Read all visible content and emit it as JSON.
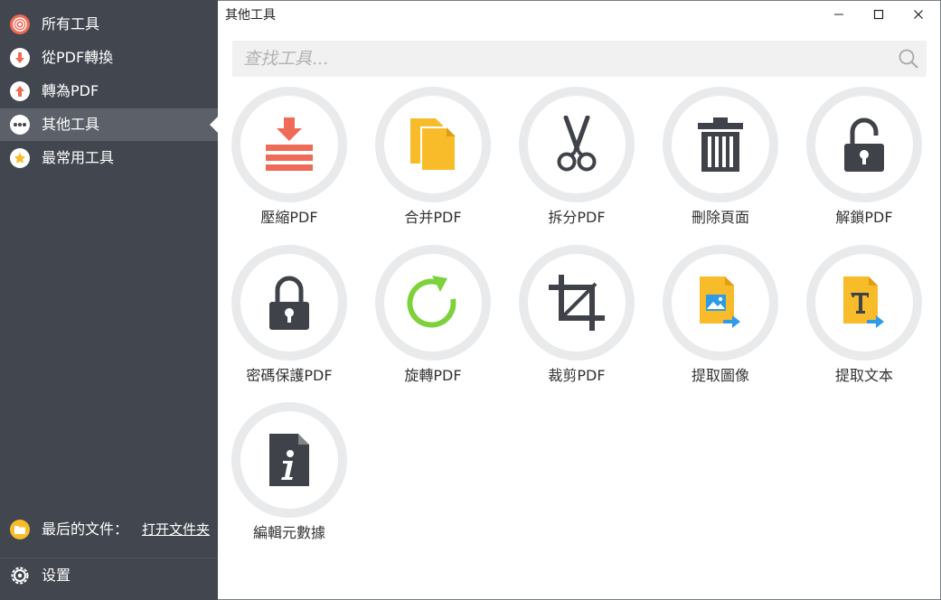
{
  "sidebar": {
    "items": [
      {
        "label": "所有工具",
        "icon": "target-icon",
        "color": "#ef6b57"
      },
      {
        "label": "從PDF轉換",
        "icon": "arrow-down-icon",
        "color": "#ef6b57"
      },
      {
        "label": "轉為PDF",
        "icon": "arrow-up-icon",
        "color": "#ef6b57"
      },
      {
        "label": "其他工具",
        "icon": "more-dots-icon",
        "color": "#ffffff"
      },
      {
        "label": "最常用工具",
        "icon": "star-icon",
        "color": "#f8bb2a"
      }
    ],
    "active_index": 3,
    "recent_label": "最后的文件：",
    "recent_link": "打开文件夹",
    "settings_label": "设置"
  },
  "window": {
    "title": "其他工具"
  },
  "search": {
    "placeholder": "查找工具..."
  },
  "tools": [
    {
      "label": "壓縮PDF",
      "icon": "compress-icon"
    },
    {
      "label": "合并PDF",
      "icon": "merge-icon"
    },
    {
      "label": "拆分PDF",
      "icon": "scissors-icon"
    },
    {
      "label": "刪除頁面",
      "icon": "trash-icon"
    },
    {
      "label": "解鎖PDF",
      "icon": "unlock-icon"
    },
    {
      "label": "密碼保護PDF",
      "icon": "lock-icon"
    },
    {
      "label": "旋轉PDF",
      "icon": "rotate-icon"
    },
    {
      "label": "裁剪PDF",
      "icon": "crop-icon"
    },
    {
      "label": "提取圖像",
      "icon": "extract-image-icon"
    },
    {
      "label": "提取文本",
      "icon": "extract-text-icon"
    },
    {
      "label": "編輯元數據",
      "icon": "metadata-info-icon"
    }
  ],
  "colors": {
    "sidebar_bg": "#41464f",
    "active_bg": "#5b6069",
    "accent_red": "#ef6b57",
    "accent_yellow": "#f8bb2a",
    "accent_green": "#7dd23c",
    "accent_blue": "#2f9be8",
    "icon_dark": "#3f4249"
  }
}
